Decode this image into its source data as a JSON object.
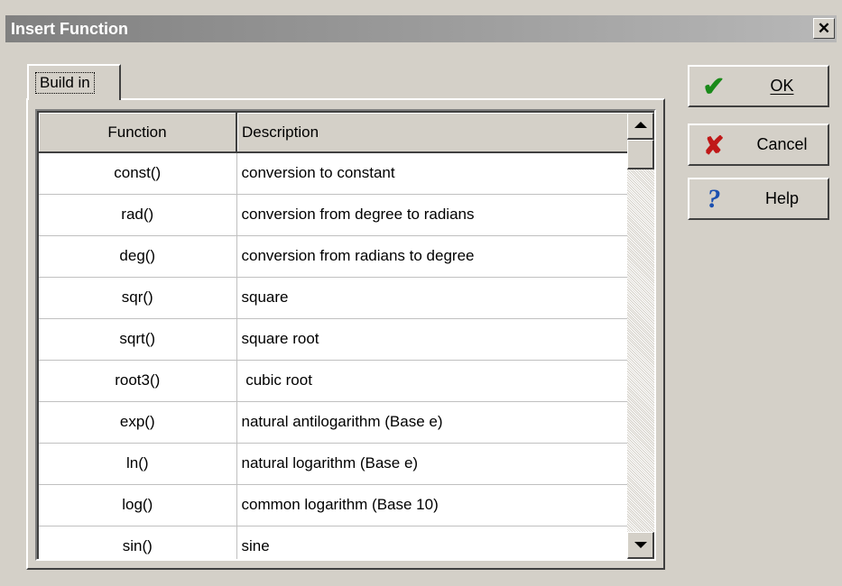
{
  "dialog": {
    "title": "Insert Function",
    "close_label": "✕"
  },
  "tab": {
    "label": "Build in"
  },
  "table": {
    "headers": {
      "function": "Function",
      "description": "Description"
    },
    "rows": [
      {
        "function": "const()",
        "description": "conversion to constant"
      },
      {
        "function": "rad()",
        "description": "conversion from degree to radians"
      },
      {
        "function": "deg()",
        "description": "conversion from radians to degree"
      },
      {
        "function": "sqr()",
        "description": "square"
      },
      {
        "function": "sqrt()",
        "description": "square root"
      },
      {
        "function": "root3()",
        "description": " cubic root"
      },
      {
        "function": "exp()",
        "description": "natural antilogarithm (Base e)"
      },
      {
        "function": "ln()",
        "description": "natural logarithm (Base e)"
      },
      {
        "function": "log()",
        "description": "common logarithm (Base 10)"
      },
      {
        "function": "sin()",
        "description": "sine"
      }
    ]
  },
  "buttons": {
    "ok": {
      "label": "OK",
      "icon": "checkmark-icon",
      "color": "#1a8a1a"
    },
    "cancel": {
      "label": "Cancel",
      "icon": "x-icon",
      "color": "#c01818"
    },
    "help": {
      "label": "Help",
      "icon": "question-icon",
      "color": "#1a4fb0"
    }
  }
}
